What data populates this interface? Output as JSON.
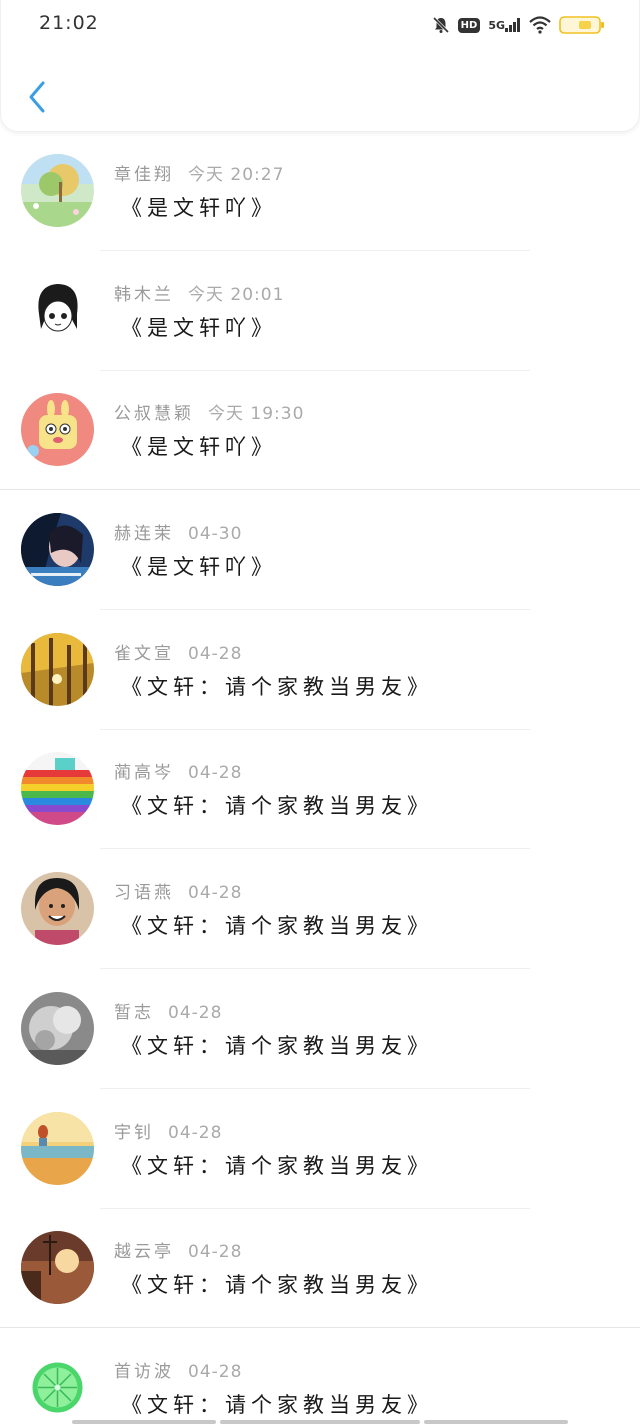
{
  "status_bar": {
    "time": "21:02",
    "network": "5G",
    "hd": "HD",
    "icons": [
      "mute-bell-icon",
      "hd-icon",
      "signal-5g-icon",
      "wifi-icon",
      "battery-icon"
    ]
  },
  "header": {
    "back_icon": "chevron-left-icon",
    "accent": "#3a9ee4"
  },
  "items": [
    {
      "name": "章佳翔",
      "time": "今天 20:27",
      "title": "《是文轩吖》",
      "avatar": "landscape"
    },
    {
      "name": "韩木兰",
      "time": "今天 20:01",
      "title": "《是文轩吖》",
      "avatar": "manga-girl"
    },
    {
      "name": "公叔慧颖",
      "time": "今天 19:30",
      "title": "《是文轩吖》",
      "avatar": "cartoon-rabbit"
    },
    {
      "name": "赫连茉",
      "time": "04-30",
      "title": "《是文轩吖》",
      "avatar": "portrait-blue"
    },
    {
      "name": "雀文宣",
      "time": "04-28",
      "title": "《文轩：请个家教当男友》",
      "avatar": "autumn-trees"
    },
    {
      "name": "蔺高岑",
      "time": "04-28",
      "title": "《文轩：请个家教当男友》",
      "avatar": "rainbow-cake"
    },
    {
      "name": "习语燕",
      "time": "04-28",
      "title": "《文轩：请个家教当男友》",
      "avatar": "smiling-man"
    },
    {
      "name": "暂志",
      "time": "04-28",
      "title": "《文轩：请个家教当男友》",
      "avatar": "grey-sculpture"
    },
    {
      "name": "宇钊",
      "time": "04-28",
      "title": "《文轩：请个家教当男友》",
      "avatar": "sunset-text"
    },
    {
      "name": "越云亭",
      "time": "04-28",
      "title": "《文轩：请个家教当男友》",
      "avatar": "street-sunset"
    },
    {
      "name": "首访波",
      "time": "04-28",
      "title": "《文轩：请个家教当男友》",
      "avatar": "lime-slice"
    }
  ]
}
